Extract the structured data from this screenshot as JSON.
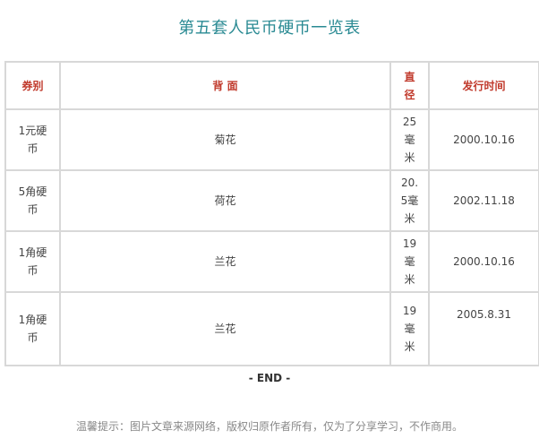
{
  "title": "第五套人民币硬币一览表",
  "table": {
    "headers": [
      "券别",
      "背 面",
      "直径",
      "发行时间"
    ],
    "rows": [
      {
        "denomination": "1元硬币",
        "reverse": "菊花",
        "diameter": "25毫米",
        "issue_date": "2000.10.16"
      },
      {
        "denomination": "5角硬币",
        "reverse": "荷花",
        "diameter": "20.5毫米",
        "issue_date": "2002.11.18"
      },
      {
        "denomination": "1角硬币",
        "reverse": "兰花",
        "diameter": "19毫米",
        "issue_date": "2000.10.16"
      },
      {
        "denomination": "1角硬币",
        "reverse": "兰花",
        "diameter": "19毫米",
        "issue_date": "2005.8.31"
      }
    ]
  },
  "end_marker": "- END -",
  "footer_note": "温馨提示：图片文章来源网络，版权归原作者所有，仅为了分享学习，不作商用。"
}
